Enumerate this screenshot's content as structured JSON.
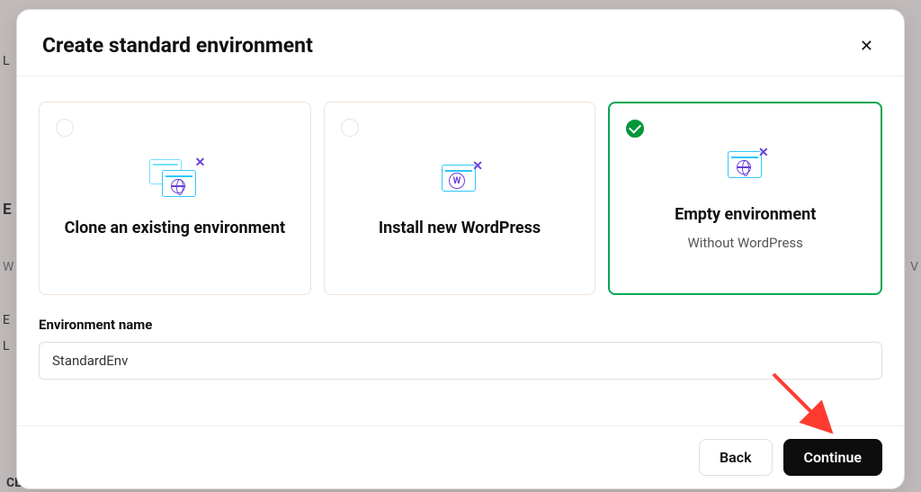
{
  "modal": {
    "title": "Create standard environment",
    "options": [
      {
        "title": "Clone an existing environment",
        "subtitle": ""
      },
      {
        "title": "Install new WordPress",
        "subtitle": ""
      },
      {
        "title": "Empty environment",
        "subtitle": "Without WordPress"
      }
    ],
    "field": {
      "label": "Environment name",
      "value": "StandardEnv"
    },
    "buttons": {
      "back": "Back",
      "continue": "Continue"
    }
  }
}
